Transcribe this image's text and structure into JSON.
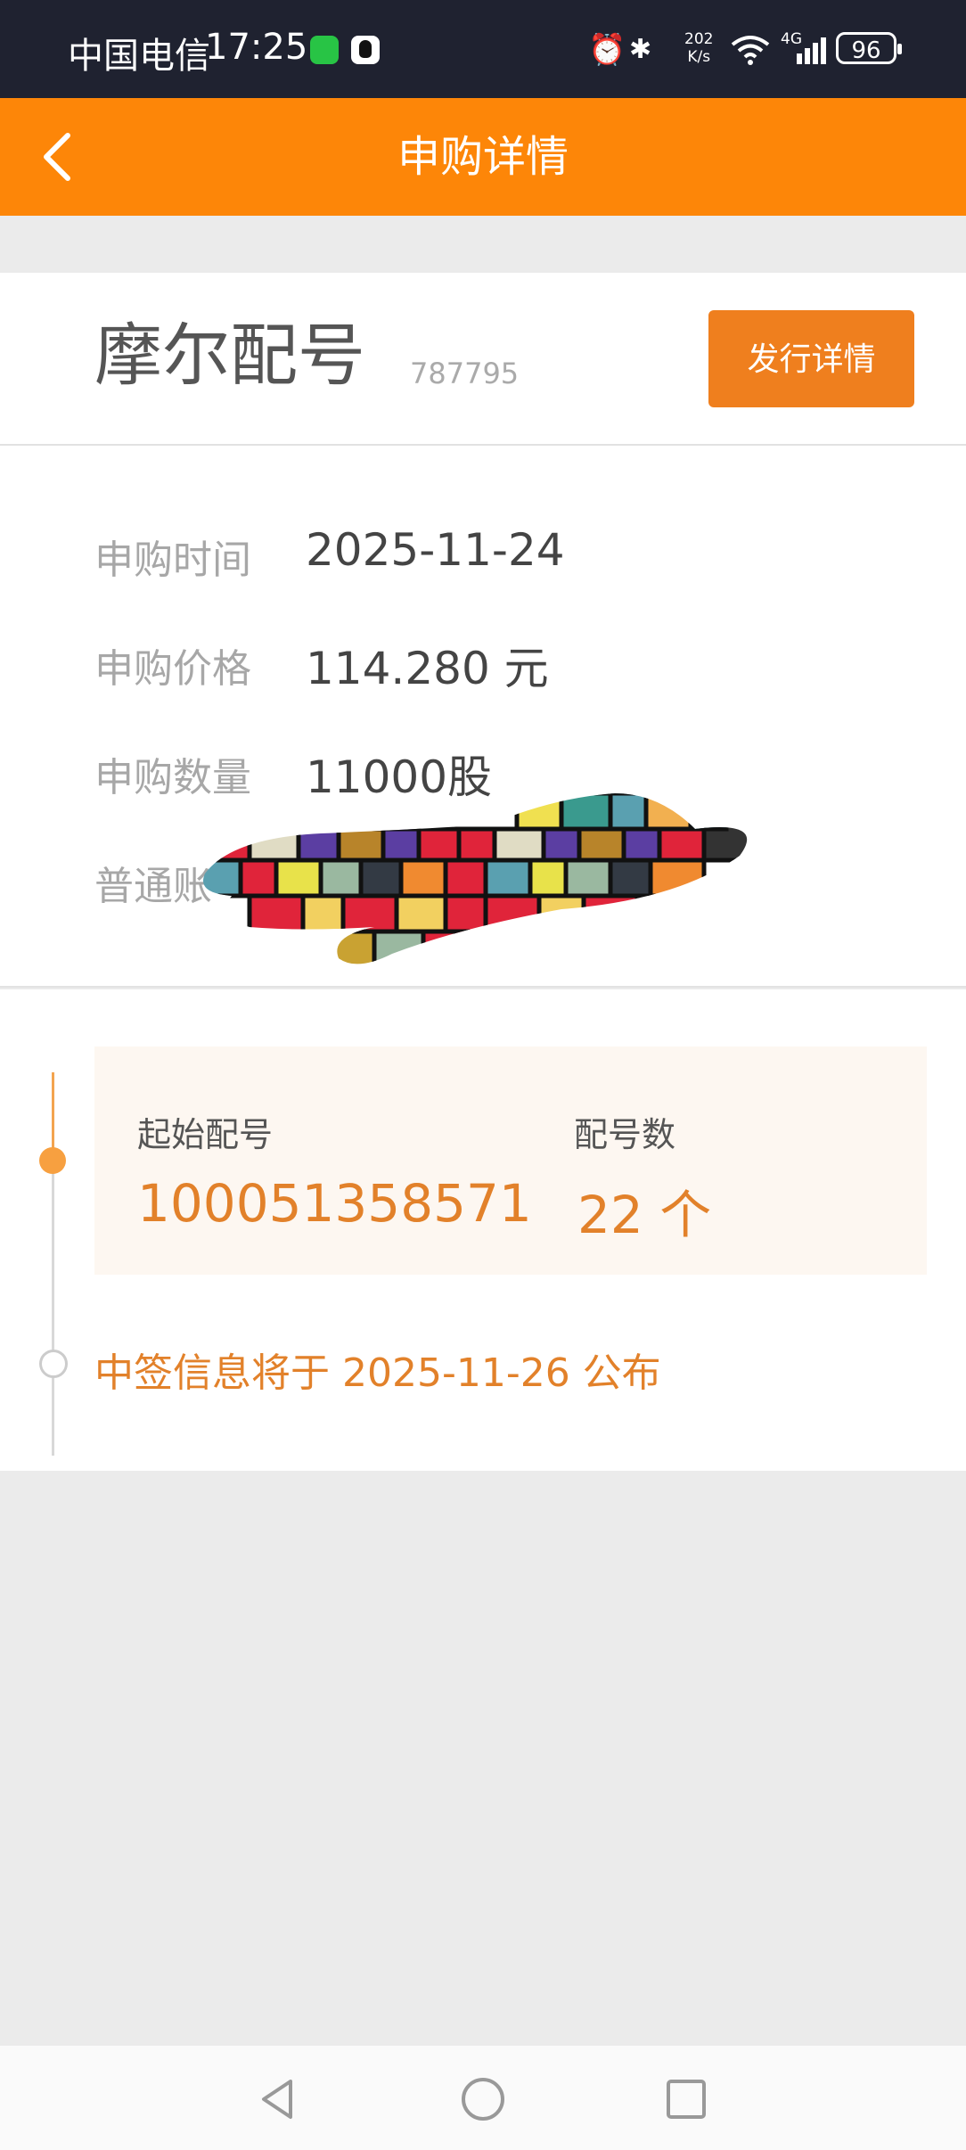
{
  "status_bar": {
    "carrier": "中国电信",
    "time": "17:25",
    "net_speed_value": "202",
    "net_speed_unit": "K/s",
    "network": "4G",
    "battery": "96",
    "icons": [
      "wechat-icon",
      "qq-icon",
      "alarm-icon",
      "bluetooth-icon",
      "speed-icon",
      "wifi-icon",
      "signal-icon",
      "battery-icon"
    ]
  },
  "header": {
    "title": "申购详情",
    "back_icon": "chevron-left-icon",
    "color": "#fd8608"
  },
  "stock": {
    "name": "摩尔配号",
    "code": "787795",
    "issue_button": "发行详情"
  },
  "info": {
    "rows": [
      {
        "label": "申购时间",
        "value": "2025-11-24"
      },
      {
        "label": "申购价格",
        "value": "114.280 元"
      },
      {
        "label": "申购数量",
        "value": "11000股"
      },
      {
        "label": "普通账",
        "value": ""
      }
    ]
  },
  "allotment": {
    "start_label": "起始配号",
    "start_value": "100051358571",
    "count_label": "配号数",
    "count_value": "22 个",
    "notice": "中签信息将于 2025-11-26 公布",
    "accent_color": "#e2812a"
  },
  "nav_bar": {
    "buttons": [
      "back-triangle-icon",
      "home-circle-icon",
      "recents-square-icon"
    ]
  }
}
